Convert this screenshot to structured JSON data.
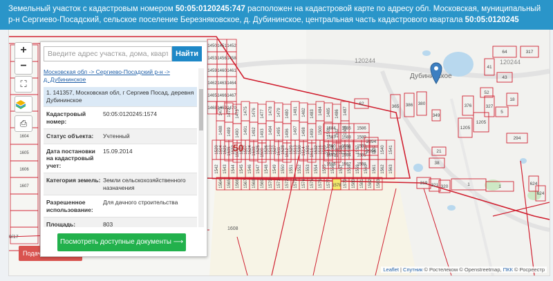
{
  "header": {
    "p1": "Земельный участок с кадастровым номером ",
    "cad": "50:05:0120245:747",
    "p2": " расположен на кадастровой карте по адресу обл. Московская, муниципальный р-н Сергиево-Посадский, сельское поселение Березняковское, д. Дубининское, центральная часть кадастрового квартала ",
    "quarter": "50:05:0120245"
  },
  "map": {
    "zoom_in": "+",
    "zoom_out": "−",
    "fullscreen_icon": "⛶",
    "print_icon": "⎙",
    "village_label": "Дубининское",
    "big_label": "50",
    "block_label_1": "120244",
    "block_label_2": "120244",
    "plot_1608": "1608",
    "plot_9_17": "9/17",
    "parcels": [
      "1450",
      "1451",
      "1452",
      "1453",
      "1456",
      "1458",
      "1459",
      "1460",
      "1461",
      "1462",
      "1463",
      "1464",
      "1465",
      "1466",
      "1467",
      "1468",
      "1469",
      "1470",
      "1471",
      "1472",
      "1473",
      "1475",
      "1476",
      "1477",
      "1478",
      "1479",
      "1480",
      "1481",
      "1482",
      "1483",
      "1484",
      "1485",
      "1486",
      "1487",
      "1488",
      "1489",
      "1490",
      "1491",
      "1492",
      "1493",
      "1494",
      "1495",
      "1496",
      "1497",
      "1498",
      "1499",
      "1500",
      "1501",
      "1502",
      "1503",
      "1504",
      "1505",
      "1506",
      "1507",
      "1508",
      "1509",
      "1510",
      "1511",
      "1512",
      "1513",
      "1514",
      "1515",
      "1516",
      "1517",
      "1518",
      "1519",
      "1520",
      "1521",
      "1522",
      "1523",
      "1524",
      "1525",
      "1526",
      "1527",
      "1528",
      "1529",
      "1530",
      "1531",
      "1532",
      "1533",
      "1534",
      "1535",
      "1536",
      "1537",
      "1538",
      "1539",
      "1540",
      "1541",
      "1542",
      "1543",
      "1544",
      "1545",
      "1546",
      "1547",
      "1548",
      "1549",
      "1550",
      "1551",
      "1552",
      "1553",
      "1554",
      "1555",
      "1556",
      "1557",
      "1558",
      "1559",
      "1560",
      "1561",
      "1562",
      "1563",
      "1564",
      "1565",
      "1566",
      "1567",
      "1568",
      "1569",
      "1570",
      "1571",
      "1572",
      "1573",
      "1574",
      "1575",
      "1576",
      "1577",
      "1578",
      "1579",
      "1580",
      "1581",
      "1582",
      "1583",
      "1584",
      "1585",
      "1586",
      "1587",
      "1588",
      "1589",
      "1590",
      "1591",
      "1592",
      "1593",
      "1594",
      "1595",
      "1596",
      "1597",
      "1598",
      "1599",
      "1600",
      "1601",
      "1602",
      "1603",
      "1604",
      "1605",
      "1606",
      "1607"
    ],
    "right_parcels": [
      "317",
      "64",
      "43",
      "18",
      "5",
      "41",
      "52",
      "38",
      "21",
      "319",
      "321",
      "320",
      "1",
      "1",
      "294",
      "1205",
      "1205",
      "624",
      "624",
      "62",
      "365",
      "386",
      "380",
      "376",
      "327",
      "349",
      "2094",
      "2096"
    ],
    "attribution": {
      "leaflet": "Leaflet",
      "sep": " | ",
      "sputnik": "Спутник",
      "rest": " © Ростелеком © Openstreetmap, ",
      "pkk": "ПКК",
      "rosreestr": " © Росреестр"
    }
  },
  "panel": {
    "search_placeholder": "Введите адрес участка, дома, квартиры",
    "find_label": "Найти",
    "crumb1": "Московская обл",
    "arrow": " -> ",
    "crumb2": "Сергиево-Посадский р-н",
    "crumb3": "д. Дубининское",
    "item": "1. 141357, Московская обл, г Сергиев Посад, деревня Дубининское",
    "rows": [
      {
        "k": "Кадастровый номер:",
        "v": "50:05:0120245:1574"
      },
      {
        "k": "Статус объекта:",
        "v": "Учтенный"
      },
      {
        "k": "Дата постановки на кадастровый учет:",
        "v": "15.09.2014"
      },
      {
        "k": "Категория земель:",
        "v": "Земли сельскохозяйственного назначения"
      },
      {
        "k": "Разрешенное использование:",
        "v": "Для дачного строительства"
      },
      {
        "k": "Площадь:",
        "v": "803"
      }
    ],
    "doc_button": "Посмотреть доступные документы ⟶",
    "red_button": "Подача заявки"
  }
}
